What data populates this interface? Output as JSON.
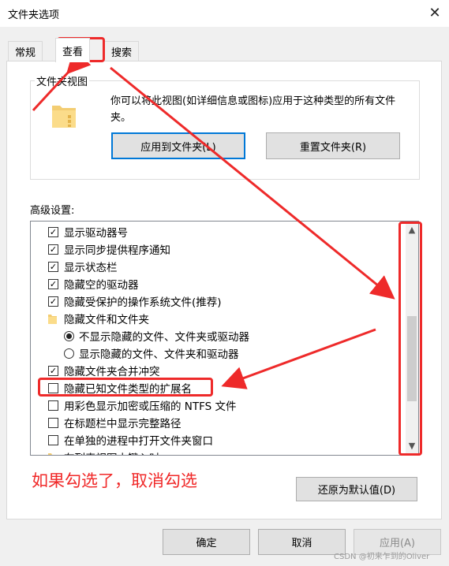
{
  "window": {
    "title": "文件夹选项",
    "close_glyph": "✕"
  },
  "tabs": [
    {
      "label": "常规"
    },
    {
      "label": "查看"
    },
    {
      "label": "搜索"
    }
  ],
  "folder_view": {
    "group_label": "文件夹视图",
    "description": "你可以将此视图(如详细信息或图标)应用于这种类型的所有文件夹。",
    "apply_button": "应用到文件夹(L)",
    "reset_button": "重置文件夹(R)"
  },
  "advanced": {
    "label": "高级设置:",
    "items": [
      {
        "type": "checkbox",
        "checked": true,
        "label": "显示驱动器号"
      },
      {
        "type": "checkbox",
        "checked": true,
        "label": "显示同步提供程序通知"
      },
      {
        "type": "checkbox",
        "checked": true,
        "label": "显示状态栏"
      },
      {
        "type": "checkbox",
        "checked": true,
        "label": "隐藏空的驱动器"
      },
      {
        "type": "checkbox",
        "checked": true,
        "label": "隐藏受保护的操作系统文件(推荐)"
      },
      {
        "type": "folder",
        "label": "隐藏文件和文件夹"
      },
      {
        "type": "radio",
        "checked": true,
        "label": "不显示隐藏的文件、文件夹或驱动器"
      },
      {
        "type": "radio",
        "checked": false,
        "label": "显示隐藏的文件、文件夹和驱动器"
      },
      {
        "type": "checkbox",
        "checked": true,
        "label": "隐藏文件夹合并冲突"
      },
      {
        "type": "checkbox",
        "checked": false,
        "label": "隐藏已知文件类型的扩展名"
      },
      {
        "type": "checkbox",
        "checked": false,
        "label": "用彩色显示加密或压缩的 NTFS 文件"
      },
      {
        "type": "checkbox",
        "checked": false,
        "label": "在标题栏中显示完整路径"
      },
      {
        "type": "checkbox",
        "checked": false,
        "label": "在单独的进程中打开文件夹窗口"
      },
      {
        "type": "folder",
        "label": "在列表视图中键入时"
      }
    ]
  },
  "restore_button": "还原为默认值(D)",
  "footer": {
    "ok": "确定",
    "cancel": "取消",
    "apply": "应用(A)"
  },
  "annotation": "如果勾选了，取消勾选",
  "watermark": "CSDN @初来乍到的Oliver",
  "colors": {
    "annotation_red": "#ee2a2a",
    "focus_blue": "#0078d7"
  }
}
